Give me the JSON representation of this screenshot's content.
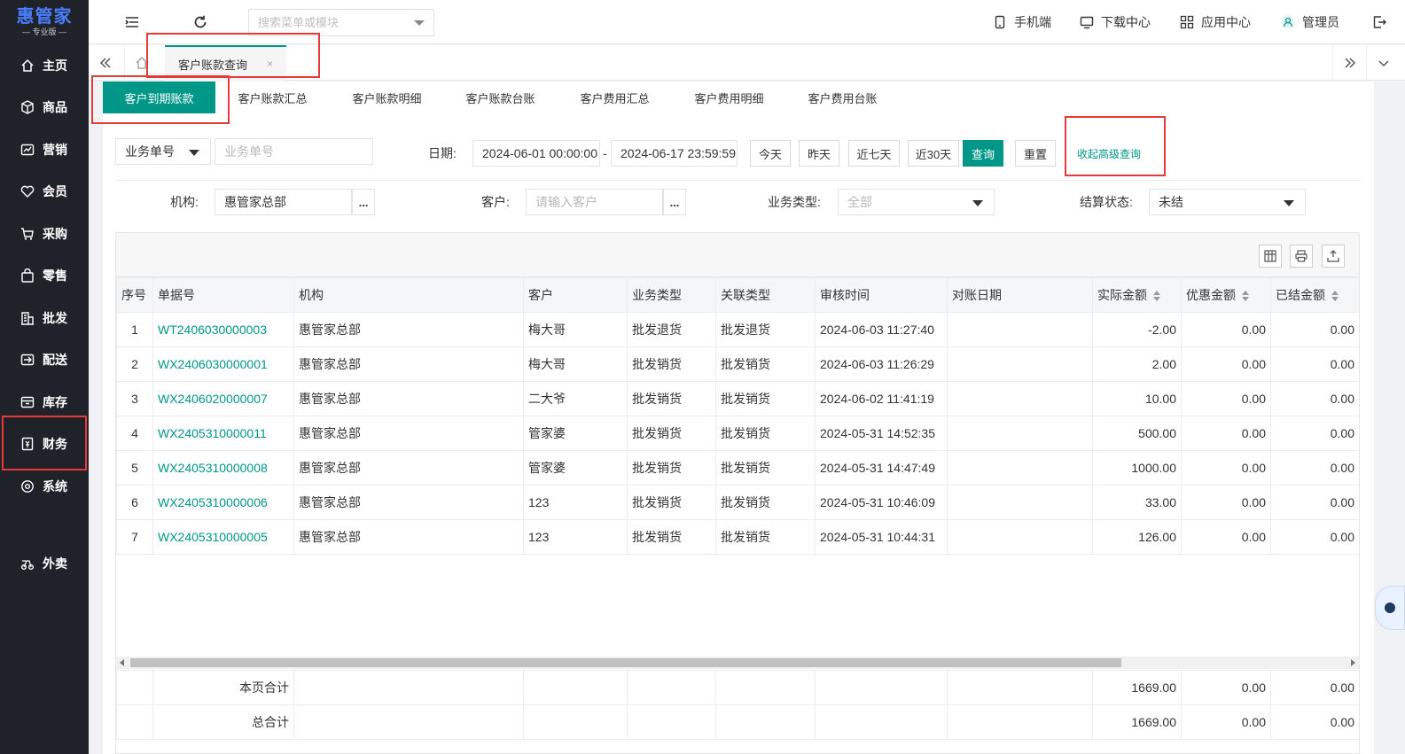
{
  "app": {
    "logo_title": "惠管家",
    "logo_sub": "— 专业版 —"
  },
  "sidebar": {
    "items": [
      {
        "label": "主页",
        "icon": "home-icon"
      },
      {
        "label": "商品",
        "icon": "box-icon"
      },
      {
        "label": "营销",
        "icon": "chart-icon"
      },
      {
        "label": "会员",
        "icon": "heart-icon"
      },
      {
        "label": "采购",
        "icon": "cart-icon"
      },
      {
        "label": "零售",
        "icon": "bag-icon"
      },
      {
        "label": "批发",
        "icon": "building-icon"
      },
      {
        "label": "配送",
        "icon": "truck-icon"
      },
      {
        "label": "库存",
        "icon": "inventory-icon"
      },
      {
        "label": "财务",
        "icon": "finance-icon",
        "active": true
      },
      {
        "label": "系统",
        "icon": "gear-icon"
      },
      {
        "label": "外卖",
        "icon": "delivery-icon"
      }
    ]
  },
  "topbar": {
    "search_placeholder": "搜索菜单或模块",
    "mobile": "手机端",
    "download": "下载中心",
    "apps": "应用中心",
    "user": "管理员"
  },
  "tabs": {
    "current": "客户账款查询",
    "close": "×"
  },
  "subtabs": [
    "客户到期账款",
    "客户账款汇总",
    "客户账款明细",
    "客户账款台账",
    "客户费用汇总",
    "客户费用明细",
    "客户费用台账"
  ],
  "filters": {
    "doc_type": "业务单号",
    "doc_placeholder": "业务单号",
    "date_label": "日期:",
    "date_start": "2024-06-01 00:00:00",
    "date_sep": "-",
    "date_end": "2024-06-17 23:59:59",
    "today": "今天",
    "yesterday": "昨天",
    "last7": "近七天",
    "last30": "近30天",
    "query": "查询",
    "reset": "重置",
    "advanced": "收起高级查询",
    "org_label": "机构:",
    "org_value": "惠管家总部",
    "customer_label": "客户:",
    "customer_placeholder": "请输入客户",
    "biz_type_label": "业务类型:",
    "biz_type_value": "全部",
    "settle_label": "结算状态:",
    "settle_value": "未结",
    "more": "..."
  },
  "table": {
    "columns": [
      "序号",
      "单据号",
      "机构",
      "客户",
      "业务类型",
      "关联类型",
      "审核时间",
      "对账日期",
      "实际金额",
      "优惠金额",
      "已结金额"
    ],
    "rows": [
      [
        "1",
        "WT2406030000003",
        "惠管家总部",
        "梅大哥",
        "批发退货",
        "批发退货",
        "2024-06-03 11:27:40",
        "",
        "-2.00",
        "0.00",
        "0.00"
      ],
      [
        "2",
        "WX2406030000001",
        "惠管家总部",
        "梅大哥",
        "批发销货",
        "批发销货",
        "2024-06-03 11:26:29",
        "",
        "2.00",
        "0.00",
        "0.00"
      ],
      [
        "3",
        "WX2406020000007",
        "惠管家总部",
        "二大爷",
        "批发销货",
        "批发销货",
        "2024-06-02 11:41:19",
        "",
        "10.00",
        "0.00",
        "0.00"
      ],
      [
        "4",
        "WX2405310000011",
        "惠管家总部",
        "管家婆",
        "批发销货",
        "批发销货",
        "2024-05-31 14:52:35",
        "",
        "500.00",
        "0.00",
        "0.00"
      ],
      [
        "5",
        "WX2405310000008",
        "惠管家总部",
        "管家婆",
        "批发销货",
        "批发销货",
        "2024-05-31 14:47:49",
        "",
        "1000.00",
        "0.00",
        "0.00"
      ],
      [
        "6",
        "WX2405310000006",
        "惠管家总部",
        "123",
        "批发销货",
        "批发销货",
        "2024-05-31 10:46:09",
        "",
        "33.00",
        "0.00",
        "0.00"
      ],
      [
        "7",
        "WX2405310000005",
        "惠管家总部",
        "123",
        "批发销货",
        "批发销货",
        "2024-05-31 10:44:31",
        "",
        "126.00",
        "0.00",
        "0.00"
      ]
    ],
    "footer": [
      {
        "label": "本页合计",
        "actual": "1669.00",
        "discount": "0.00",
        "settled": "0.00"
      },
      {
        "label": "总合计",
        "actual": "1669.00",
        "discount": "0.00",
        "settled": "0.00"
      }
    ]
  },
  "colors": {
    "primary": "#009688",
    "sidebar": "#1f2329",
    "highlight": "#e5393a"
  }
}
